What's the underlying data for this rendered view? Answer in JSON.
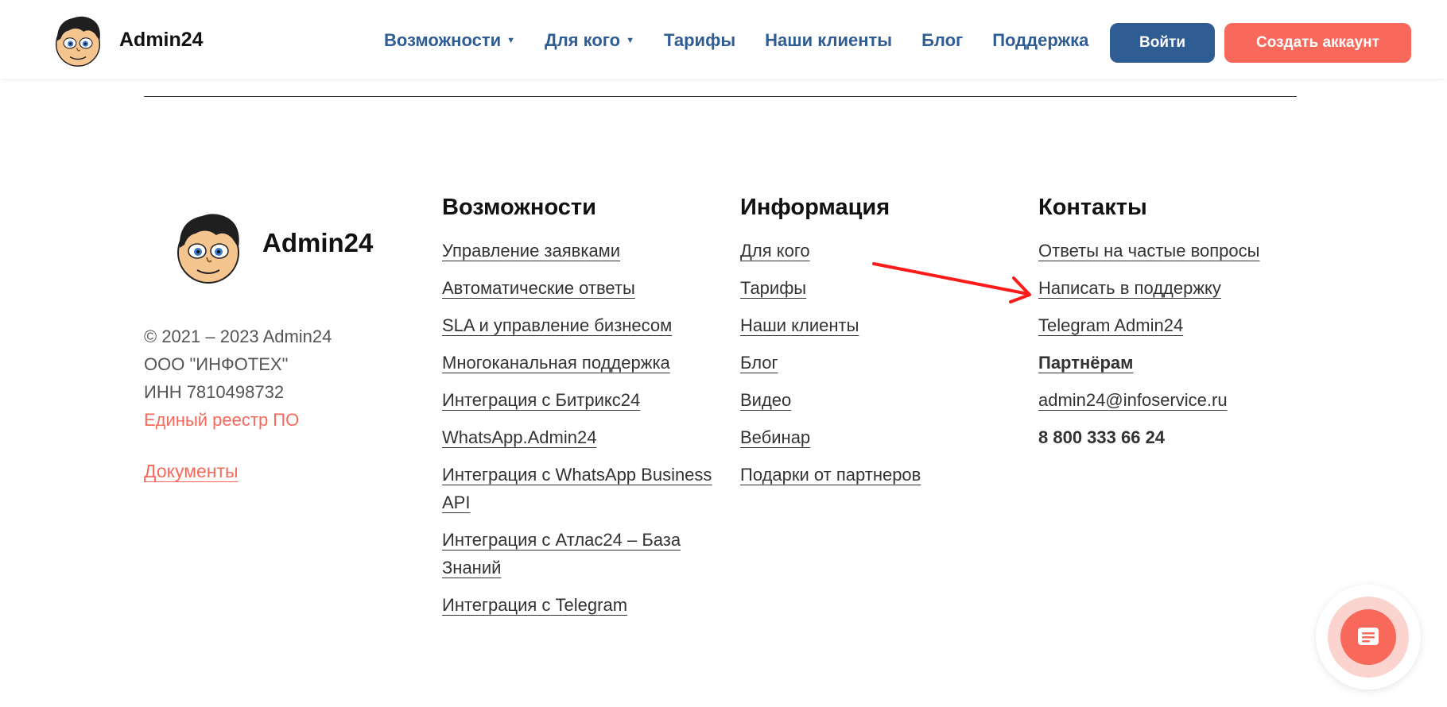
{
  "header": {
    "brand": "Admin24",
    "logo_icon": "cartoon-avatar-logo",
    "nav": [
      {
        "label": "Возможности",
        "has_dropdown": true
      },
      {
        "label": "Для кого",
        "has_dropdown": true
      },
      {
        "label": "Тарифы",
        "has_dropdown": false
      },
      {
        "label": "Наши клиенты",
        "has_dropdown": false
      },
      {
        "label": "Блог",
        "has_dropdown": false
      },
      {
        "label": "Поддержка",
        "has_dropdown": false
      }
    ],
    "login_label": "Войти",
    "signup_label": "Создать аккаунт"
  },
  "footer": {
    "brand": "Admin24",
    "company": {
      "copyright": "© 2021 – 2023 Admin24",
      "org": "ООО \"ИНФОТЕХ\"",
      "inn": "ИНН 7810498732",
      "registry_link": "Единый реестр ПО",
      "documents_link": "Документы"
    },
    "features": {
      "title": "Возможности",
      "links": [
        "Управление заявками",
        "Автоматические ответы",
        "SLA и управление бизнесом",
        "Многоканальная поддержка",
        "Интеграция с Битрикс24",
        "WhatsApp.Admin24",
        "Интеграция с WhatsApp Business API",
        "Интеграция с Атлас24 – База Знаний",
        "Интеграция с Telegram"
      ]
    },
    "info": {
      "title": "Информация",
      "links": [
        "Для кого",
        "Тарифы",
        "Наши клиенты",
        "Блог",
        "Видео",
        "Вебинар",
        "Подарки от партнеров"
      ]
    },
    "contacts": {
      "title": "Контакты",
      "links": [
        "Ответы на частые вопросы",
        "Написать в поддержку",
        "Telegram Admin24"
      ],
      "partners_label": "Партнёрам",
      "email": "admin24@infoservice.ru",
      "phone": "8 800 333 66 24"
    }
  },
  "chat_widget": {
    "icon": "chat-message-icon"
  },
  "colors": {
    "primary": "#2f5d93",
    "accent": "#f8695b",
    "annotation_arrow": "#ff1a1a"
  }
}
